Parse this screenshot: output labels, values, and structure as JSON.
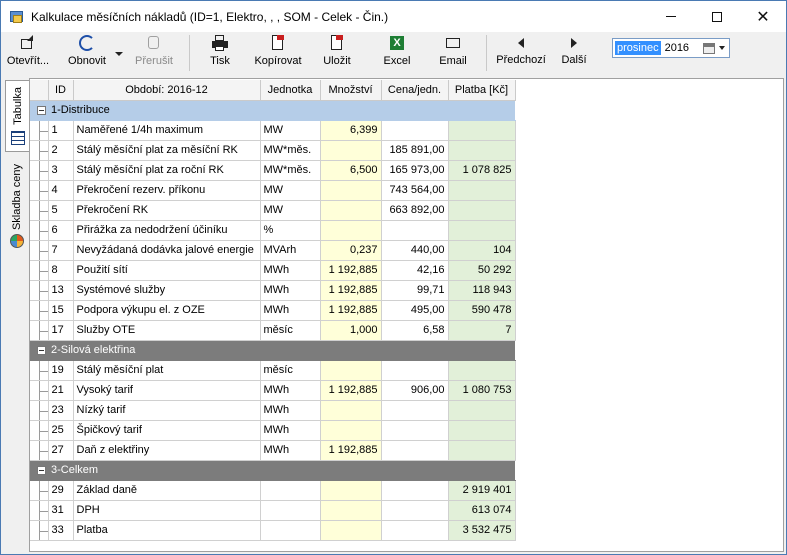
{
  "window": {
    "title": "Kalkulace měsíčních nákladů (ID=1, Elektro, , , SOM - Celek - Čin.)"
  },
  "toolbar": {
    "open": "Otevřít...",
    "refresh": "Obnovit",
    "recalc": "Přerušit",
    "print": "Tisk",
    "copy": "Kopírovat",
    "save": "Uložit",
    "excel": "Excel",
    "email": "Email",
    "prev": "Předchozí",
    "next": "Další"
  },
  "period": {
    "month": "prosinec",
    "year": "2016"
  },
  "sidetabs": {
    "table": "Tabulka",
    "price": "Skladba ceny"
  },
  "columns": {
    "id": "ID",
    "name": "Období: 2016-12",
    "unit": "Jednotka",
    "qty": "Množství",
    "price": "Cena/jedn.",
    "pay": "Platba [Kč]"
  },
  "groups": [
    {
      "title": "1-Distribuce",
      "style": "light",
      "rows": [
        {
          "id": "1",
          "name": "Naměřené 1/4h maximum",
          "unit": "MW",
          "qty": "6,399",
          "price": "",
          "pay": ""
        },
        {
          "id": "2",
          "name": "Stálý měsíční plat za měsíční RK",
          "unit": "MW*měs.",
          "qty": "",
          "price": "185 891,00",
          "pay": ""
        },
        {
          "id": "3",
          "name": "Stálý měsíční plat za roční RK",
          "unit": "MW*měs.",
          "qty": "6,500",
          "price": "165 973,00",
          "pay": "1 078 825"
        },
        {
          "id": "4",
          "name": "Překročení rezerv. příkonu",
          "unit": "MW",
          "qty": "",
          "price": "743 564,00",
          "pay": ""
        },
        {
          "id": "5",
          "name": "Překročení RK",
          "unit": "MW",
          "qty": "",
          "price": "663 892,00",
          "pay": ""
        },
        {
          "id": "6",
          "name": "Přirážka za nedodržení účiníku",
          "unit": "%",
          "qty": "",
          "price": "",
          "pay": ""
        },
        {
          "id": "7",
          "name": "Nevyžádaná dodávka jalové energie",
          "unit": "MVArh",
          "qty": "0,237",
          "price": "440,00",
          "pay": "104"
        },
        {
          "id": "8",
          "name": "Použití sítí",
          "unit": "MWh",
          "qty": "1 192,885",
          "price": "42,16",
          "pay": "50 292"
        },
        {
          "id": "13",
          "name": "Systémové služby",
          "unit": "MWh",
          "qty": "1 192,885",
          "price": "99,71",
          "pay": "118 943"
        },
        {
          "id": "15",
          "name": "Podpora výkupu el. z OZE",
          "unit": "MWh",
          "qty": "1 192,885",
          "price": "495,00",
          "pay": "590 478"
        },
        {
          "id": "17",
          "name": "Služby OTE",
          "unit": "měsíc",
          "qty": "1,000",
          "price": "6,58",
          "pay": "7"
        }
      ]
    },
    {
      "title": "2-Silová elektřina",
      "style": "dark",
      "rows": [
        {
          "id": "19",
          "name": "Stálý měsíční plat",
          "unit": "měsíc",
          "qty": "",
          "price": "",
          "pay": ""
        },
        {
          "id": "21",
          "name": "Vysoký tarif",
          "unit": "MWh",
          "qty": "1 192,885",
          "price": "906,00",
          "pay": "1 080 753"
        },
        {
          "id": "23",
          "name": "Nízký tarif",
          "unit": "MWh",
          "qty": "",
          "price": "",
          "pay": ""
        },
        {
          "id": "25",
          "name": "Špičkový tarif",
          "unit": "MWh",
          "qty": "",
          "price": "",
          "pay": ""
        },
        {
          "id": "27",
          "name": "Daň z elektřiny",
          "unit": "MWh",
          "qty": "1 192,885",
          "price": "",
          "pay": ""
        }
      ]
    },
    {
      "title": "3-Celkem",
      "style": "dark",
      "rows": [
        {
          "id": "29",
          "name": "Základ daně",
          "unit": "",
          "qty": "",
          "price": "",
          "pay": "2 919 401"
        },
        {
          "id": "31",
          "name": "DPH",
          "unit": "",
          "qty": "",
          "price": "",
          "pay": "613 074"
        },
        {
          "id": "33",
          "name": "Platba",
          "unit": "",
          "qty": "",
          "price": "",
          "pay": "3 532 475"
        }
      ]
    }
  ],
  "colors": {
    "group_light": "#b5cde8",
    "group_dark": "#7c7c7c",
    "qty_bg": "#ffffd9",
    "pay_bg": "#e2f0d9"
  }
}
